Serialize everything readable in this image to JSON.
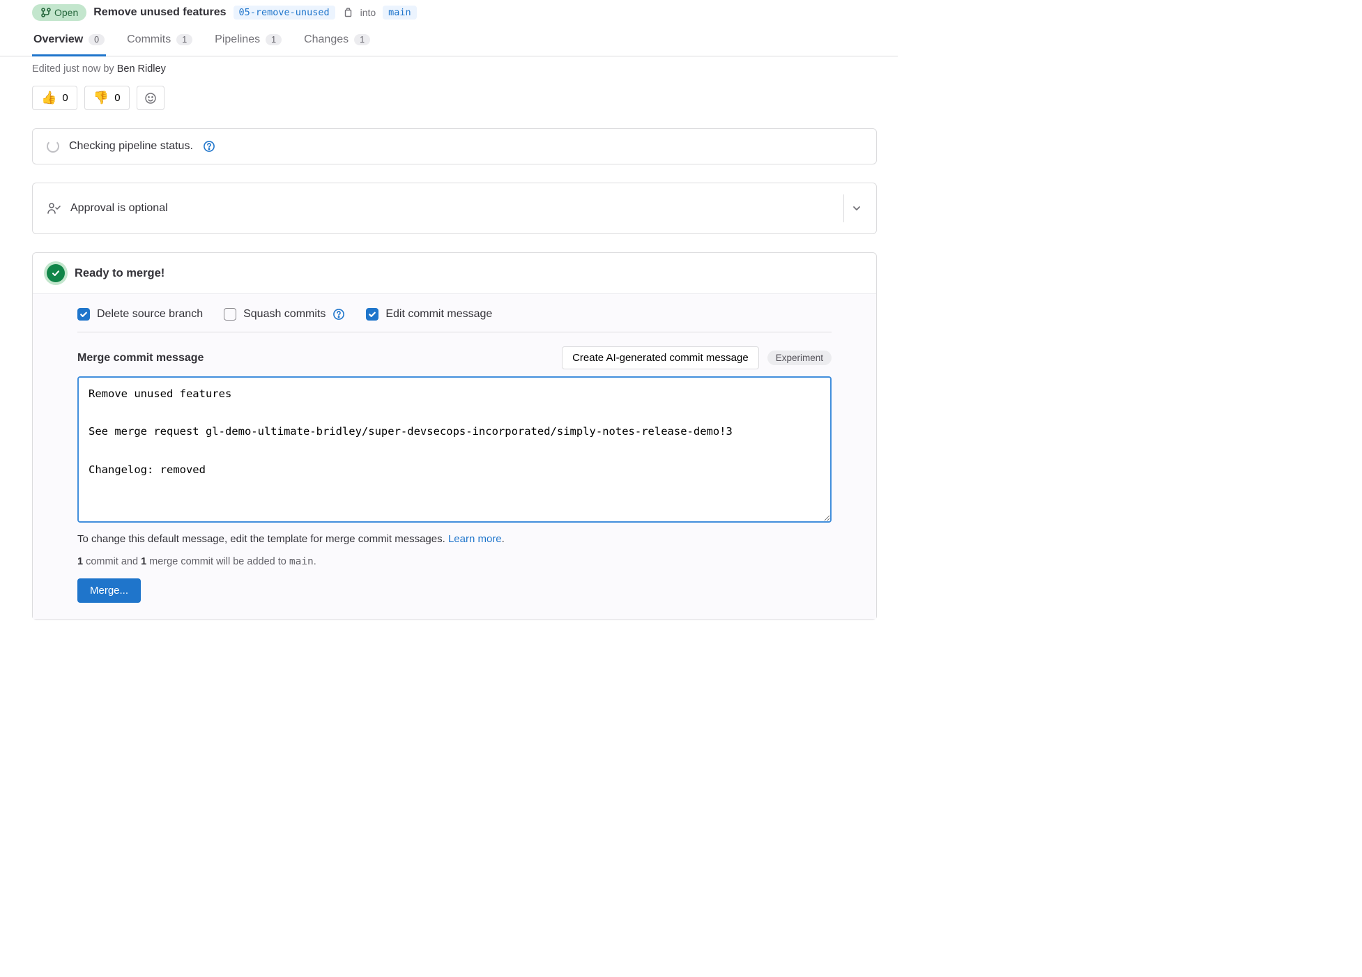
{
  "header": {
    "status": "Open",
    "title": "Remove unused features",
    "source_branch": "05-remove-unused",
    "into_label": "into",
    "target_branch": "main"
  },
  "tabs": {
    "overview": {
      "label": "Overview",
      "count": "0"
    },
    "commits": {
      "label": "Commits",
      "count": "1"
    },
    "pipelines": {
      "label": "Pipelines",
      "count": "1"
    },
    "changes": {
      "label": "Changes",
      "count": "1"
    }
  },
  "edited": {
    "prefix": "Edited just now by ",
    "author": "Ben Ridley"
  },
  "reactions": {
    "thumbs_up": "0",
    "thumbs_down": "0"
  },
  "pipeline_status": "Checking pipeline status.",
  "approval": "Approval is optional",
  "merge": {
    "ready": "Ready to merge!",
    "checkboxes": {
      "delete_source": "Delete source branch",
      "squash": "Squash commits",
      "edit_msg": "Edit commit message"
    },
    "msg_label": "Merge commit message",
    "ai_button": "Create AI-generated commit message",
    "experiment_badge": "Experiment",
    "commit_message": "Remove unused features\n\nSee merge request gl-demo-ultimate-bridley/super-devsecops-incorporated/simply-notes-release-demo!3\n\nChangelog: removed",
    "hint_text": "To change this default message, edit the template for merge commit messages. ",
    "hint_link": "Learn more",
    "commit_count_parts": {
      "a": "1",
      "b": " commit and ",
      "c": "1",
      "d": " merge commit will be added to ",
      "e": "main",
      "f": "."
    },
    "merge_button": "Merge..."
  }
}
